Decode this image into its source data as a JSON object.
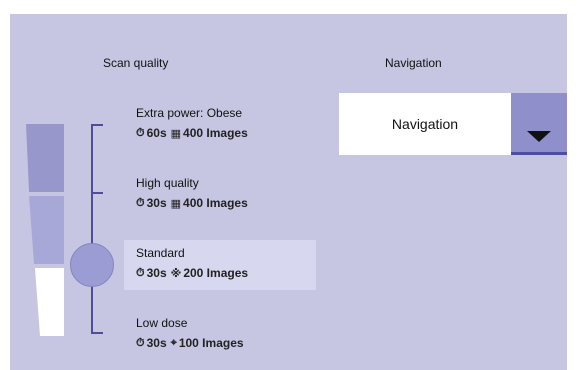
{
  "scan_quality": {
    "title": "Scan quality",
    "options": [
      {
        "name": "Extra power: Obese",
        "time": "60s",
        "images": "400 Images",
        "time_icon": "timer-icon",
        "images_icon": "image-grid-dense-icon",
        "selected": false
      },
      {
        "name": "High quality",
        "time": "30s",
        "images": "400 Images",
        "time_icon": "timer-icon",
        "images_icon": "image-grid-dense-icon",
        "selected": false
      },
      {
        "name": "Standard",
        "time": "30s",
        "images": "200 Images",
        "time_icon": "timer-icon",
        "images_icon": "image-grid-medium-icon",
        "selected": true
      },
      {
        "name": "Low dose",
        "time": "30s",
        "images": "100 Images",
        "time_icon": "timer-icon",
        "images_icon": "image-grid-sparse-icon",
        "selected": false
      }
    ],
    "selected_level": "Standard"
  },
  "navigation": {
    "title": "Navigation",
    "selected_value": "Navigation"
  },
  "colors": {
    "panel_background": "#c6c6e2",
    "selected_row": "#d7d7ef",
    "accent": "#8f8fcb",
    "accent_dark": "#4e4ea2"
  }
}
